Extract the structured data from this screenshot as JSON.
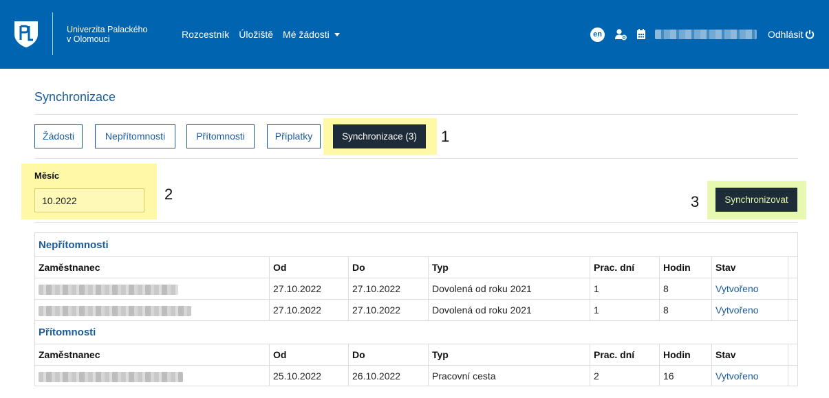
{
  "header": {
    "university_line1": "Univerzita Palackého",
    "university_line2": "v Olomouci",
    "nav": [
      "Rozcestník",
      "Úložiště",
      "Mé žádosti"
    ],
    "lang": "en",
    "logout": "Odhlásit"
  },
  "page": {
    "title": "Synchronizace"
  },
  "tabs": [
    {
      "label": "Žádosti"
    },
    {
      "label": "Nepřítomnosti"
    },
    {
      "label": "Přítomnosti"
    },
    {
      "label": "Příplatky"
    },
    {
      "label": "Synchronizace (3)",
      "active": true
    }
  ],
  "annotations": [
    "1",
    "2",
    "3"
  ],
  "month_field": {
    "label": "Měsíc",
    "value": "10.2022"
  },
  "sync_button": "Synchronizovat",
  "absences": {
    "title": "Nepřítomnosti",
    "columns": [
      "Zaměstnanec",
      "Od",
      "Do",
      "Typ",
      "Prac. dní",
      "Hodin",
      "Stav"
    ],
    "rows": [
      {
        "od": "27.10.2022",
        "do": "27.10.2022",
        "typ": "Dovolená od roku 2021",
        "dni": "1",
        "hodin": "8",
        "stav": "Vytvořeno"
      },
      {
        "od": "27.10.2022",
        "do": "27.10.2022",
        "typ": "Dovolená od roku 2021",
        "dni": "1",
        "hodin": "8",
        "stav": "Vytvořeno"
      }
    ]
  },
  "attendances": {
    "title": "Přítomnosti",
    "columns": [
      "Zaměstnanec",
      "Od",
      "Do",
      "Typ",
      "Prac. dní",
      "Hodin",
      "Stav"
    ],
    "rows": [
      {
        "od": "25.10.2022",
        "do": "26.10.2022",
        "typ": "Pracovní cesta",
        "dni": "2",
        "hodin": "16",
        "stav": "Vytvořeno"
      }
    ]
  },
  "colors": {
    "header_bg": "#0064b0",
    "accent": "#1a5c9c",
    "dark_button": "#1e2b38",
    "highlight_yellow": "#fff8a6",
    "highlight_green": "#e7f9b0"
  }
}
